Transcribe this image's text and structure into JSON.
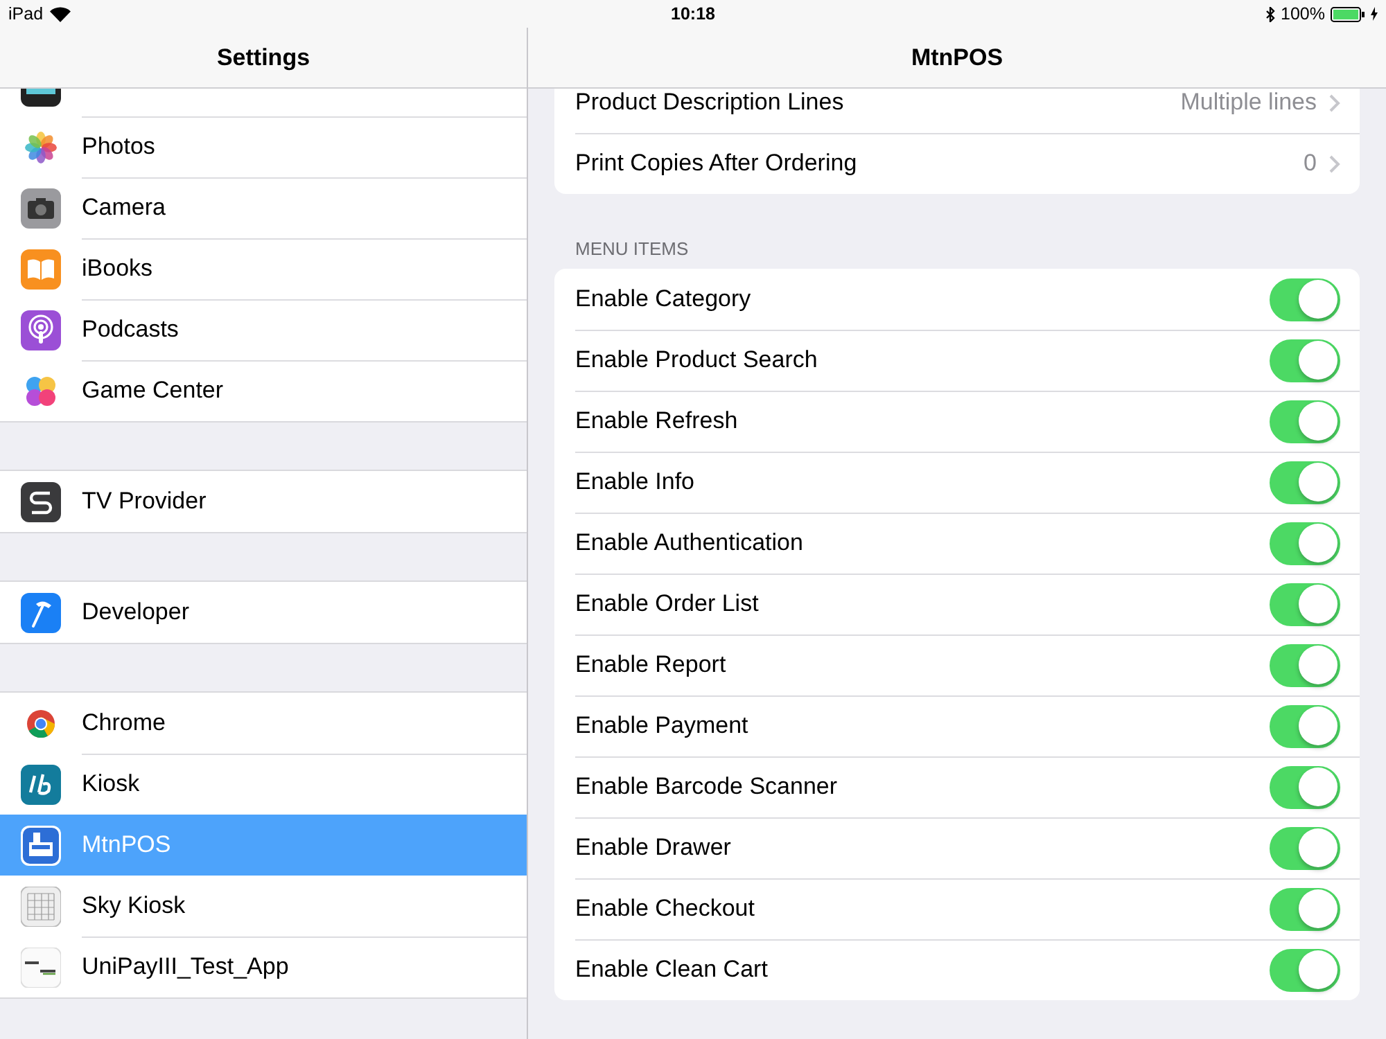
{
  "status_bar": {
    "device": "iPad",
    "time": "10:18",
    "battery": "100%"
  },
  "sidebar": {
    "title": "Settings",
    "groups": [
      {
        "items": [
          {
            "label": "Photos",
            "selected": false
          },
          {
            "label": "Camera",
            "selected": false
          },
          {
            "label": "iBooks",
            "selected": false
          },
          {
            "label": "Podcasts",
            "selected": false
          },
          {
            "label": "Game Center",
            "selected": false
          }
        ]
      },
      {
        "items": [
          {
            "label": "TV Provider",
            "selected": false
          }
        ]
      },
      {
        "items": [
          {
            "label": "Developer",
            "selected": false
          }
        ]
      },
      {
        "items": [
          {
            "label": "Chrome",
            "selected": false
          },
          {
            "label": "Kiosk",
            "selected": false
          },
          {
            "label": "MtnPOS",
            "selected": true
          },
          {
            "label": "Sky Kiosk",
            "selected": false
          },
          {
            "label": "UniPayIII_Test_App",
            "selected": false
          }
        ]
      }
    ]
  },
  "detail": {
    "title": "MtnPOS",
    "rows": [
      {
        "label": "Product Description Lines",
        "value": "Multiple lines"
      },
      {
        "label": "Print Copies After Ordering",
        "value": "0"
      }
    ],
    "section_header": "MENU ITEMS",
    "menu_items": [
      {
        "label": "Enable Category",
        "on": true
      },
      {
        "label": "Enable Product Search",
        "on": true
      },
      {
        "label": "Enable Refresh",
        "on": true
      },
      {
        "label": "Enable Info",
        "on": true
      },
      {
        "label": "Enable Authentication",
        "on": true
      },
      {
        "label": "Enable Order List",
        "on": true
      },
      {
        "label": "Enable Report",
        "on": true
      },
      {
        "label": "Enable Payment",
        "on": true
      },
      {
        "label": "Enable Barcode Scanner",
        "on": true
      },
      {
        "label": "Enable Drawer",
        "on": true
      },
      {
        "label": "Enable Checkout",
        "on": true
      },
      {
        "label": "Enable Clean Cart",
        "on": true
      }
    ]
  }
}
